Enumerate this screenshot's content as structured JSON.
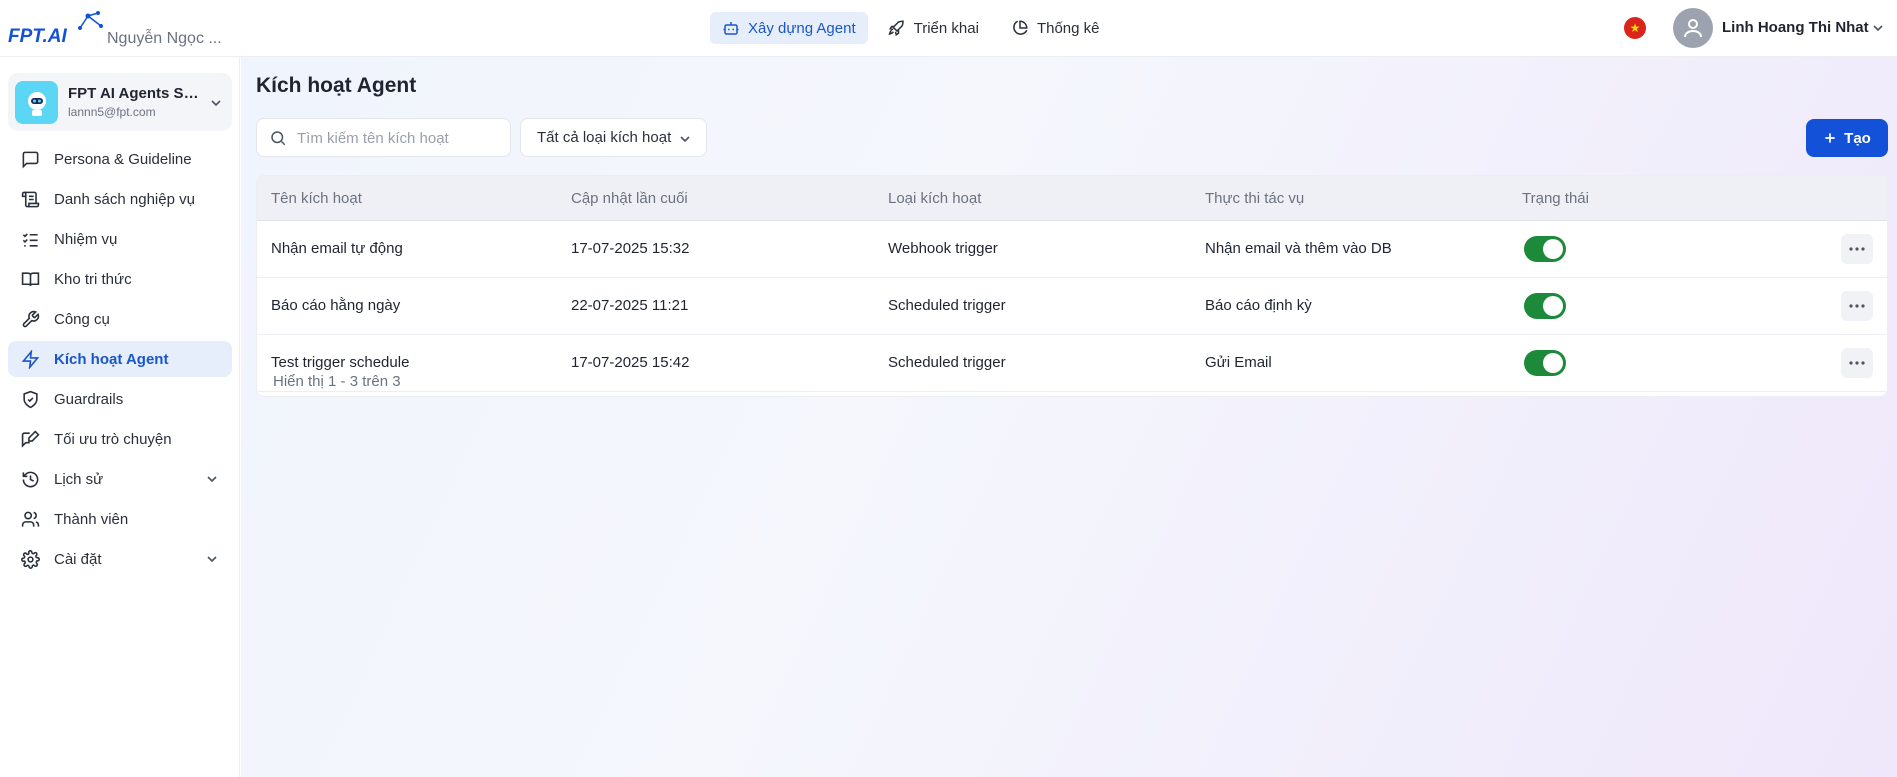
{
  "header": {
    "org_name": "Nguyễn Ngọc ...",
    "nav": [
      {
        "label": "Xây dựng Agent",
        "icon": "robot-icon",
        "active": true
      },
      {
        "label": "Triển khai",
        "icon": "rocket-icon",
        "active": false
      },
      {
        "label": "Thống kê",
        "icon": "pie-chart-icon",
        "active": false
      }
    ],
    "user_name": "Linh Hoang Thi Nhat",
    "language_flag": "vietnam-flag-icon"
  },
  "sidebar": {
    "workspace": {
      "name": "FPT AI Agents Su...",
      "email": "lannn5@fpt.com"
    },
    "items": [
      {
        "label": "Persona & Guideline",
        "icon": "message-square-icon"
      },
      {
        "label": "Danh sách nghiệp vụ",
        "icon": "scroll-icon"
      },
      {
        "label": "Nhiệm vụ",
        "icon": "list-checks-icon"
      },
      {
        "label": "Kho tri thức",
        "icon": "book-open-icon"
      },
      {
        "label": "Công cụ",
        "icon": "wrench-icon"
      },
      {
        "label": "Kích hoạt Agent",
        "icon": "lightning-icon",
        "active": true
      },
      {
        "label": "Guardrails",
        "icon": "shield-check-icon"
      },
      {
        "label": "Tối ưu trò chuyện",
        "icon": "chat-edit-icon"
      },
      {
        "label": "Lịch sử",
        "icon": "history-icon",
        "expandable": true
      },
      {
        "label": "Thành viên",
        "icon": "users-icon"
      },
      {
        "label": "Cài đặt",
        "icon": "gear-icon",
        "expandable": true
      }
    ]
  },
  "main": {
    "title": "Kích hoạt Agent",
    "search_placeholder": "Tìm kiếm tên kích hoạt",
    "filter_label": "Tất cả loại kích hoạt",
    "create_label": "Tạo",
    "columns": [
      "Tên kích hoạt",
      "Cập nhật lần cuối",
      "Loại kích hoạt",
      "Thực thi tác vụ",
      "Trạng thái"
    ],
    "rows": [
      {
        "name": "Nhận email tự động",
        "updated": "17-07-2025 15:32",
        "type": "Webhook trigger",
        "task": "Nhận email và thêm vào DB",
        "enabled": true
      },
      {
        "name": "Báo cáo hằng ngày",
        "updated": "22-07-2025 11:21",
        "type": "Scheduled trigger",
        "task": "Báo cáo định kỳ",
        "enabled": true
      },
      {
        "name": "Test trigger schedule",
        "updated": "17-07-2025 15:42",
        "type": "Scheduled trigger",
        "task": "Gửi Email",
        "enabled": true
      }
    ],
    "pagination": "Hiển thị 1 - 3 trên 3"
  },
  "colors": {
    "primary": "#1351d8",
    "active_bg": "#e6eefc",
    "toggle_on": "#1c8a3a"
  }
}
